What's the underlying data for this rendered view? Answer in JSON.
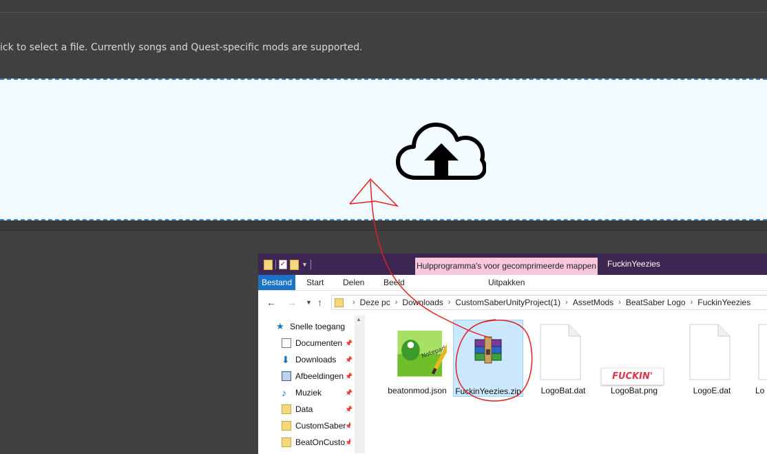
{
  "page": {
    "instruction": "ick to select a file. Currently songs and Quest-specific mods are supported."
  },
  "dropzone": {
    "icon": "cloud-upload-icon"
  },
  "annotation": {
    "color": "#e02020"
  },
  "explorer": {
    "window_title": "FuckinYeezies",
    "contextual_tab": "Hulpprogramma's voor gecomprimeerde mappen",
    "ribbon_tabs": [
      "Bestand",
      "Start",
      "Delen",
      "Beeld"
    ],
    "contextual_subtab": "Uitpakken",
    "breadcrumb": [
      "Deze pc",
      "Downloads",
      "CustomSaberUnityProject(1)",
      "AssetMods",
      "BeatSaber Logo",
      "FuckinYeezies"
    ],
    "nav": [
      {
        "label": "Snelle toegang",
        "icon": "star-icon"
      },
      {
        "label": "Documenten",
        "icon": "document-icon"
      },
      {
        "label": "Downloads",
        "icon": "download-icon"
      },
      {
        "label": "Afbeeldingen",
        "icon": "picture-icon"
      },
      {
        "label": "Muziek",
        "icon": "music-icon"
      },
      {
        "label": "Data",
        "icon": "folder-icon"
      },
      {
        "label": "CustomSaber",
        "icon": "folder-icon"
      },
      {
        "label": "BeatOnCusto",
        "icon": "folder-icon"
      }
    ],
    "files": [
      {
        "name": "beatonmod.json",
        "icon": "notepad-plus-plus-icon"
      },
      {
        "name": "FuckinYeezies.zip",
        "icon": "winrar-archive-icon"
      },
      {
        "name": "LogoBat.dat",
        "icon": "blank-file-icon"
      },
      {
        "name": "LogoBat.png",
        "icon": "image-thumbnail",
        "thumb_text": "FUCKIN'"
      },
      {
        "name": "LogoE.dat",
        "icon": "blank-file-icon"
      },
      {
        "name": "Lo",
        "icon": "blank-file-icon"
      }
    ]
  }
}
